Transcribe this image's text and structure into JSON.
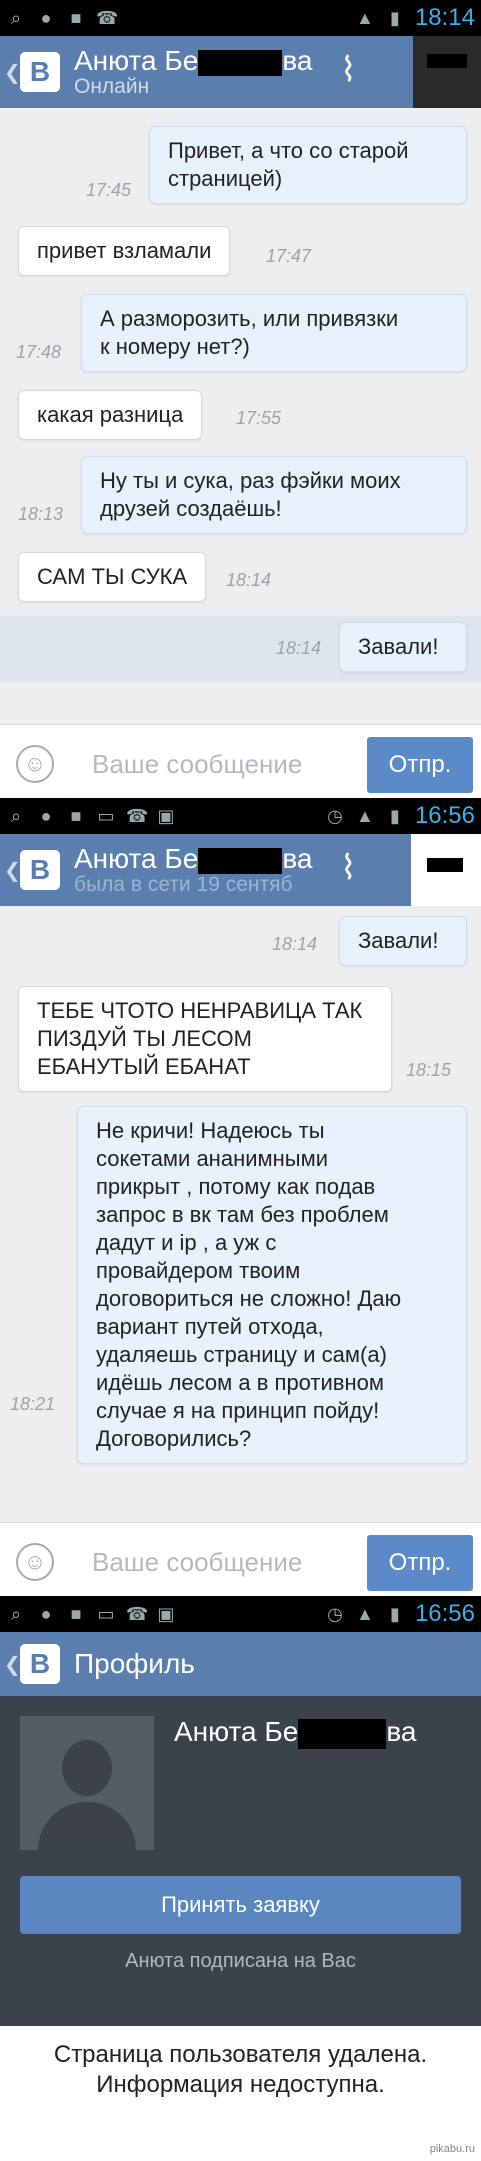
{
  "screen1": {
    "time": "18:14",
    "title_prefix": "Анюта Бе",
    "title_suffix": "ва",
    "status": "Онлайн",
    "messages": [
      {
        "text": "Привет, а что со старой\nстраницей)",
        "time": "17:45",
        "dir": "out"
      },
      {
        "text": "привет взламали",
        "time": "17:47",
        "dir": "in"
      },
      {
        "text": "А разморозить, или привязки\nк номеру нет?)",
        "time": "17:48",
        "dir": "out"
      },
      {
        "text": "какая разница",
        "time": "17:55",
        "dir": "in"
      },
      {
        "text": "Ну ты и сука, раз фэйки моих\nдрузей создаёшь!",
        "time": "18:13",
        "dir": "out"
      },
      {
        "text": "САМ ТЫ СУКА",
        "time": "18:14",
        "dir": "in"
      },
      {
        "text": "Завали!",
        "time": "18:14",
        "dir": "out"
      }
    ],
    "input_placeholder": "Ваше сообщение",
    "send_label": "Отпр."
  },
  "screen2": {
    "time": "16:56",
    "title_prefix": "Анюта Бе",
    "title_suffix": "ва",
    "status": "была в сети 19 сентяб",
    "messages": [
      {
        "text": "Завали!",
        "time": "18:14",
        "dir": "out"
      },
      {
        "text": "ТЕБЕ ЧТОТО НЕНРАВИЦА ТАК\nПИЗДУЙ ТЫ ЛЕСОМ\nЕБАНУТЫЙ ЕБАНАТ",
        "time": "18:15",
        "dir": "in"
      },
      {
        "text": "Не кричи! Надеюсь ты\nсокетами ананимными\nприкрыт , потому как подав\nзапрос в вк там без проблем\nдадут и ip , а уж с\nпровайдером твоим\nдоговориться не сложно! Даю\nвариант путей отхода,\nудаляешь страницу и сам(а)\nидёшь лесом а в противном\nслучае я на принцип пойду!\nДоговорились?",
        "time": "18:21",
        "dir": "out"
      }
    ],
    "input_placeholder": "Ваше сообщение",
    "send_label": "Отпр."
  },
  "screen3": {
    "time": "16:56",
    "title": "Профиль",
    "name_prefix": "Анюта Бе",
    "name_suffix": "ва",
    "accept_label": "Принять заявку",
    "subscribed_text": "Анюта подписана на Вас",
    "deleted_text": "Страница пользователя удалена.\nИнформация недоступна."
  },
  "vk_logo": "В",
  "watermark": "pikabu.ru",
  "colors": {
    "appbar": "#5a7fae",
    "status_time": "#3ab0e8",
    "send": "#5a8bc8",
    "profile_bg": "#3b424c"
  }
}
